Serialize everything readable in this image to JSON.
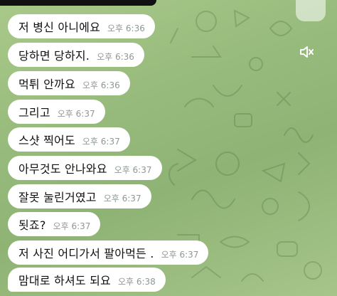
{
  "messages": [
    {
      "text": "저 병신 아니에요",
      "time": "오후 6:36"
    },
    {
      "text": "당하면 당하지.",
      "time": "오후 6:36"
    },
    {
      "text": "먹튀 안까요",
      "time": "오후 6:36"
    },
    {
      "text": "그리고",
      "time": "오후 6:37"
    },
    {
      "text": "스샷 찍어도",
      "time": "오후 6:37"
    },
    {
      "text": "아무것도 안나와요",
      "time": "오후 6:37"
    },
    {
      "text": "잘못 눌린거였고",
      "time": "오후 6:37"
    },
    {
      "text": "됫죠?",
      "time": "오후 6:37"
    },
    {
      "text": "저 사진 어디가서 팔아먹든 .",
      "time": "오후 6:37"
    },
    {
      "text": "맘대로  하셔도 되요",
      "time": "오후 6:38"
    }
  ],
  "icons": {
    "mute": "muted-speaker-icon"
  },
  "colors": {
    "bubble": "#ffffff",
    "time": "#8e9896",
    "background": "#9cbf80"
  }
}
